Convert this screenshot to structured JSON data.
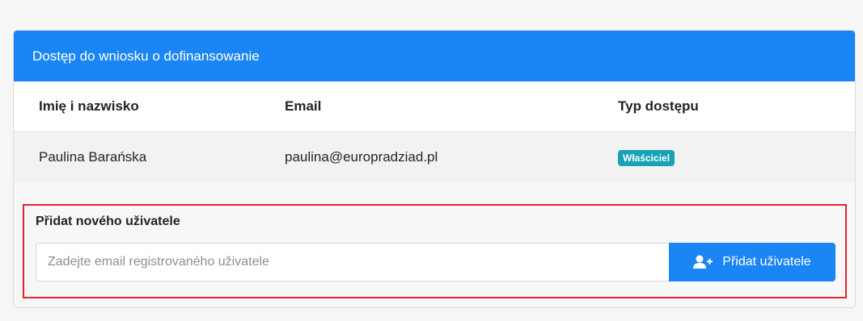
{
  "panel": {
    "title": "Dostęp do wniosku o dofinansowanie"
  },
  "table": {
    "headers": [
      "Imię i nazwisko",
      "Email",
      "Typ dostępu"
    ],
    "rows": [
      {
        "name": "Paulina Barańska",
        "email": "paulina@europradziad.pl",
        "access_type": "Właściciel"
      }
    ]
  },
  "add_user": {
    "title": "Přidat nového uživatele",
    "input_placeholder": "Zadejte email registrovaného uživatele",
    "input_value": "",
    "button_label": "Přidat uživatele",
    "button_icon": "user-plus-icon"
  },
  "colors": {
    "primary": "#1a86f5",
    "badge": "#17a2b8",
    "highlight_border": "#e2242b"
  }
}
